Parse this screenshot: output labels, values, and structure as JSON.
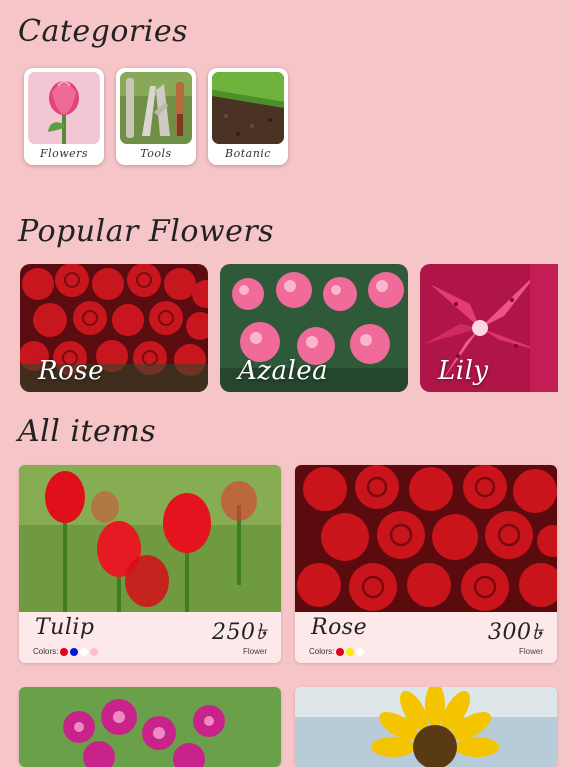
{
  "sections": {
    "categories_title": "Categories",
    "popular_title": "Popular Flowers",
    "all_items_title": "All items"
  },
  "categories": [
    {
      "label": "Flowers"
    },
    {
      "label": "Tools"
    },
    {
      "label": "Botanic"
    }
  ],
  "popular": [
    {
      "label": "Rose"
    },
    {
      "label": "Azalea"
    },
    {
      "label": "Lily"
    }
  ],
  "items": [
    {
      "name": "Tulip",
      "price": "250৳",
      "colors_label": "Colors:",
      "type": "Flower",
      "colors": [
        "#e0001b",
        "#0018d8",
        "#ffffff",
        "#ffc0cb"
      ]
    },
    {
      "name": "Rose",
      "price": "300৳",
      "colors_label": "Colors:",
      "type": "Flower",
      "colors": [
        "#e0001b",
        "#ffea00",
        "#ffffff"
      ]
    }
  ]
}
